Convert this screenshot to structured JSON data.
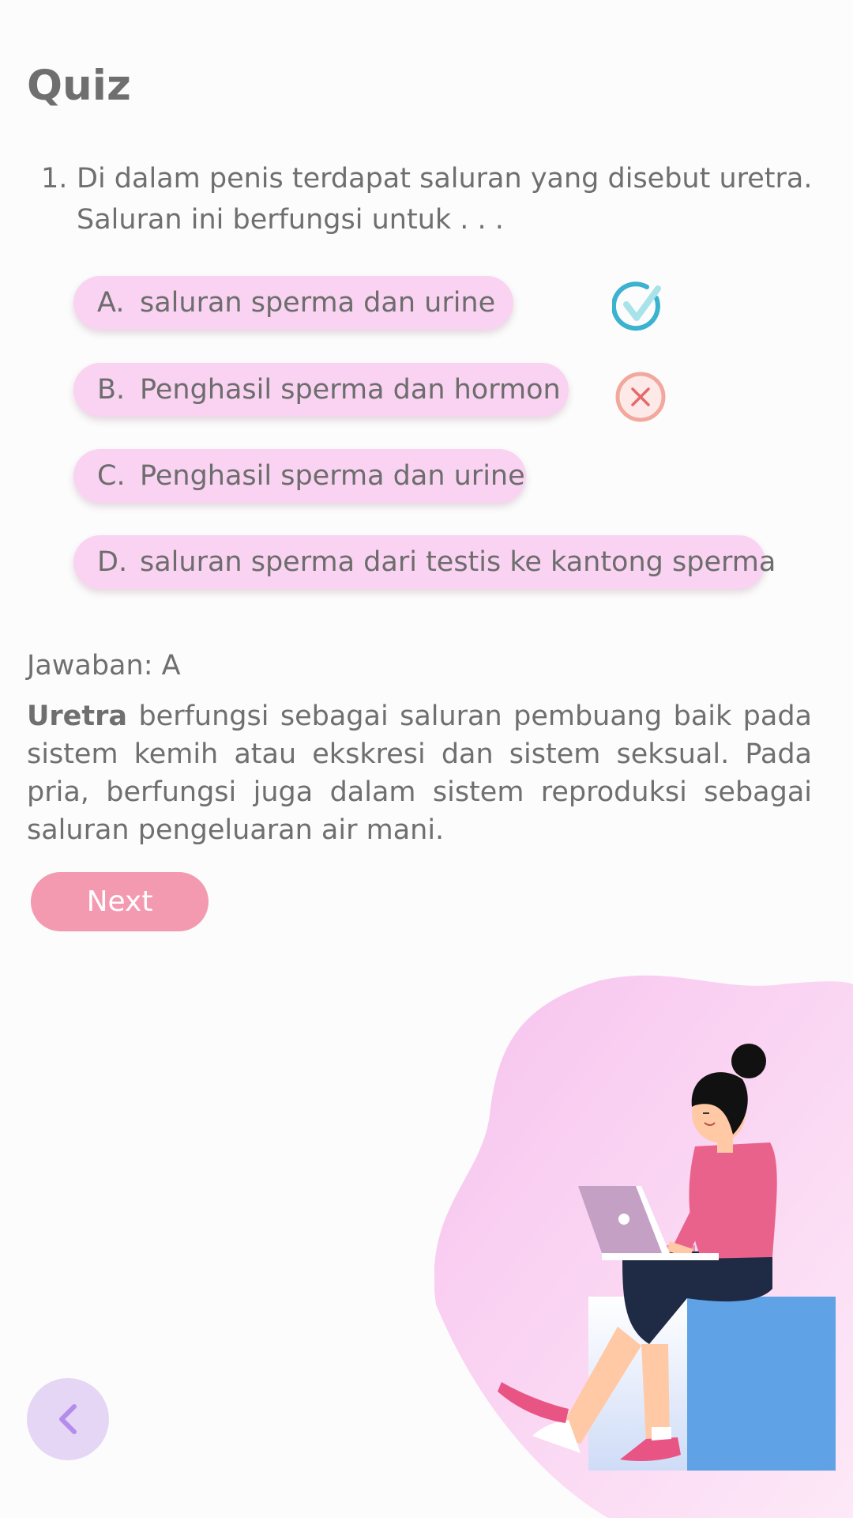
{
  "page": {
    "title": "Quiz"
  },
  "question": {
    "number": "1.",
    "text": "Di dalam penis terdapat saluran yang disebut uretra. Saluran ini berfungsi untuk . . ."
  },
  "options": [
    {
      "letter": "A.",
      "text": "saluran sperma dan urine",
      "state": "correct"
    },
    {
      "letter": "B.",
      "text": "Penghasil sperma dan hormon",
      "state": "wrong"
    },
    {
      "letter": "C.",
      "text": "Penghasil sperma dan urine",
      "state": "none"
    },
    {
      "letter": "D.",
      "text": "saluran sperma dari testis ke kantong sperma",
      "state": "none"
    }
  ],
  "answer": {
    "label": "Jawaban: A",
    "term": "Uretra",
    "explanation": " berfungsi sebagai saluran pembuang baik pada sistem kemih atau ekskresi dan sistem seksual. Pada pria, berfungsi juga dalam sistem reproduksi sebagai saluran pengeluaran air mani."
  },
  "buttons": {
    "next": "Next"
  },
  "icons": {
    "correct": "check-circle-icon",
    "wrong": "close-circle-icon",
    "back": "chevron-left-icon",
    "illustration": "woman-with-laptop-illustration"
  },
  "colors": {
    "option_bg": "#f9d3f1",
    "next_bg": "#f49ab0",
    "correct": "#3bb2cf",
    "wrong": "#f2a89c",
    "back_bg": "#e6d6f6"
  }
}
